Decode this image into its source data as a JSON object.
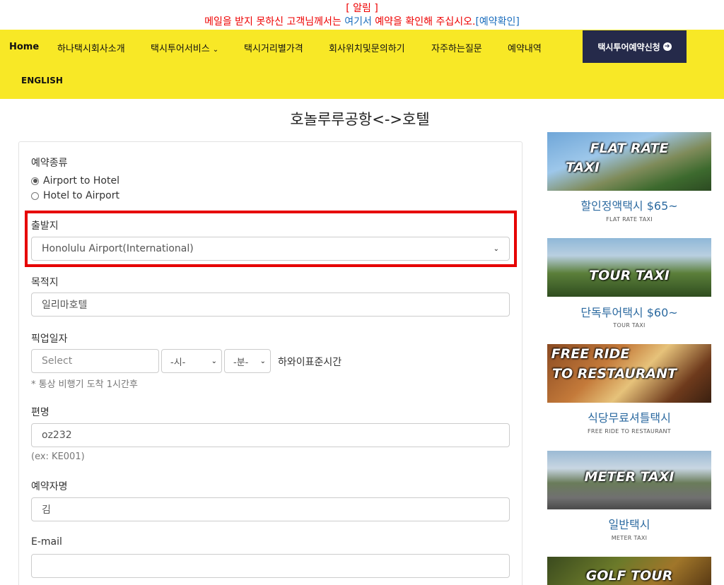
{
  "notice": {
    "title": "[ 알림 ]",
    "line_before": "메일을 받지 못하신 고객님께서는 ",
    "link_text": "여기서",
    "line_after": " 예약을 확인해 주십시오.",
    "confirm_link": "[예약확인]"
  },
  "nav": {
    "items": [
      "Home",
      "하나택시회사소개",
      "택시투어서비스",
      "택시거리별가격",
      "회사위치및문의하기",
      "자주하는질문",
      "예약내역",
      "ENGLISH"
    ],
    "cta": "택시투어예약신청",
    "bg_color": "#f8e826",
    "cta_color": "#252a4a"
  },
  "page_title": "호놀루루공항<->호텔",
  "form": {
    "reservation_type_label": "예약종류",
    "radio_options": [
      "Airport to Hotel",
      "Hotel to Airport"
    ],
    "selected_radio": "Airport to Hotel",
    "departure_label": "출발지",
    "departure_value": "Honolulu Airport(International)",
    "destination_label": "목적지",
    "destination_value": "일리마호텔",
    "pickup_label": "픽업일자",
    "date_placeholder": "Select",
    "hour_value": "-시-",
    "minute_value": "-분-",
    "timezone_text": "하와이표준시간",
    "pickup_hint": "* 통상 비행기 도착 1시간후",
    "flight_label": "편명",
    "flight_value": "oz232",
    "flight_hint": "(ex: KE001)",
    "name_label": "예약자명",
    "name_value": "김",
    "email_label": "E-mail",
    "email_value": ""
  },
  "sidebar": [
    {
      "image_text_1": "FLAT RATE",
      "image_text_2": "TAXI",
      "title": "할인정액택시 $65~",
      "sub": "FLAT RATE TAXI"
    },
    {
      "image_text_1": "TOUR TAXI",
      "image_text_2": "",
      "title": "단독투어택시 $60~",
      "sub": "TOUR TAXI"
    },
    {
      "image_text_1": "FREE RIDE",
      "image_text_2": "TO RESTAURANT",
      "title": "식당무료셔틀택시",
      "sub": "FREE RIDE TO RESTAURANT"
    },
    {
      "image_text_1": "METER TAXI",
      "image_text_2": "",
      "title": "일반택시",
      "sub": "METER TAXI"
    },
    {
      "image_text_1": "GOLF TOUR",
      "image_text_2": "",
      "title": "",
      "sub": ""
    }
  ]
}
